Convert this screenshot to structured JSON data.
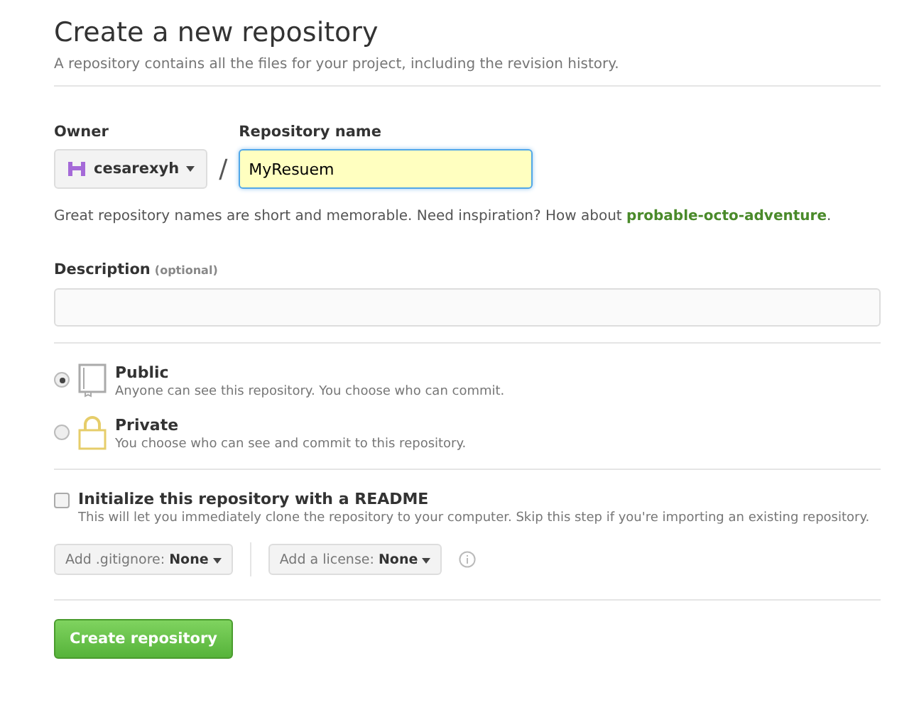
{
  "header": {
    "title": "Create a new repository",
    "subtitle": "A repository contains all the files for your project, including the revision history."
  },
  "owner": {
    "label": "Owner",
    "value": "cesarexyh"
  },
  "separator": "/",
  "repo_name": {
    "label": "Repository name",
    "value": "MyResuem"
  },
  "hint": {
    "text": "Great repository names are short and memorable. Need inspiration? How about ",
    "suggestion": "probable-octo-adventure",
    "end": "."
  },
  "description": {
    "label": "Description",
    "note": "(optional)"
  },
  "visibility": [
    {
      "kind": "public",
      "title": "Public",
      "text": "Anyone can see this repository. You choose who can commit.",
      "selected": true
    },
    {
      "kind": "private",
      "title": "Private",
      "text": "You choose who can see and commit to this repository.",
      "selected": false
    }
  ],
  "readme": {
    "label": "Initialize this repository with a README",
    "text": "This will let you immediately clone the repository to your computer. Skip this step if you're importing an existing repository.",
    "checked": false
  },
  "dropdowns": [
    {
      "label": "Add .gitignore:",
      "value": "None"
    },
    {
      "label": "Add a license:",
      "value": "None"
    }
  ],
  "submit": "Create repository"
}
